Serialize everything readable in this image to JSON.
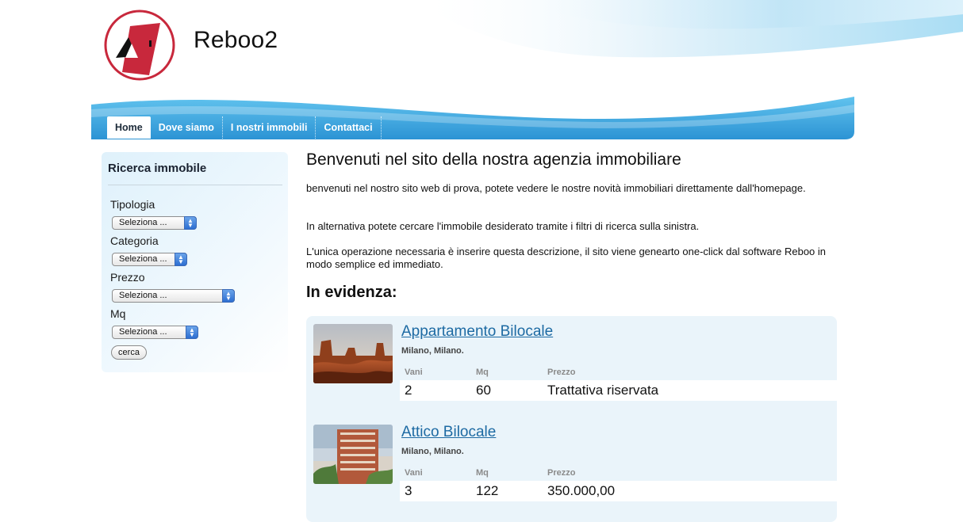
{
  "header": {
    "site_title": "Reboo2"
  },
  "nav": {
    "items": [
      {
        "label": "Home",
        "active": true
      },
      {
        "label": "Dove siamo",
        "active": false
      },
      {
        "label": "I nostri immobili",
        "active": false
      },
      {
        "label": "Contattaci",
        "active": false
      }
    ]
  },
  "sidebar": {
    "title": "Ricerca immobile",
    "fields": [
      {
        "label": "Tipologia",
        "selected": "Seleziona ..."
      },
      {
        "label": "Categoria",
        "selected": "Seleziona ..."
      },
      {
        "label": "Prezzo",
        "selected": "Seleziona ..."
      },
      {
        "label": "Mq",
        "selected": "Seleziona ..."
      }
    ],
    "search_button": "cerca"
  },
  "main": {
    "title": "Benvenuti nel sito della nostra agenzia immobiliare",
    "paragraphs": [
      "benvenuti nel nostro sito web di prova, potete vedere le nostre novità immobiliari direttamente dall'homepage.",
      "In alternativa potete cercare l'immobile desiderato tramite i filtri di ricerca sulla sinistra.",
      "L'unica operazione necessaria è inserire questa descrizione, il sito viene genearto one-click dal software Reboo in modo semplice ed immediato."
    ],
    "featured_heading": "In evidenza:"
  },
  "listings": {
    "column_headers": {
      "rooms": "Vani",
      "sqm": "Mq",
      "price": "Prezzo"
    },
    "items": [
      {
        "title": "Appartamento Bilocale",
        "location": "Milano, Milano.",
        "rooms": "2",
        "sqm": "60",
        "price": "Trattativa riservata",
        "image": "desert-landscape-photo"
      },
      {
        "title": "Attico Bilocale",
        "location": "Milano, Milano.",
        "rooms": "3",
        "sqm": "122",
        "price": "350.000,00",
        "image": "apartment-building-photo"
      }
    ]
  },
  "colors": {
    "nav_blue": "#3aa9e2",
    "link_blue": "#1d6aa3",
    "logo_red": "#c8283c",
    "listing_bg": "#eaf4fa"
  }
}
